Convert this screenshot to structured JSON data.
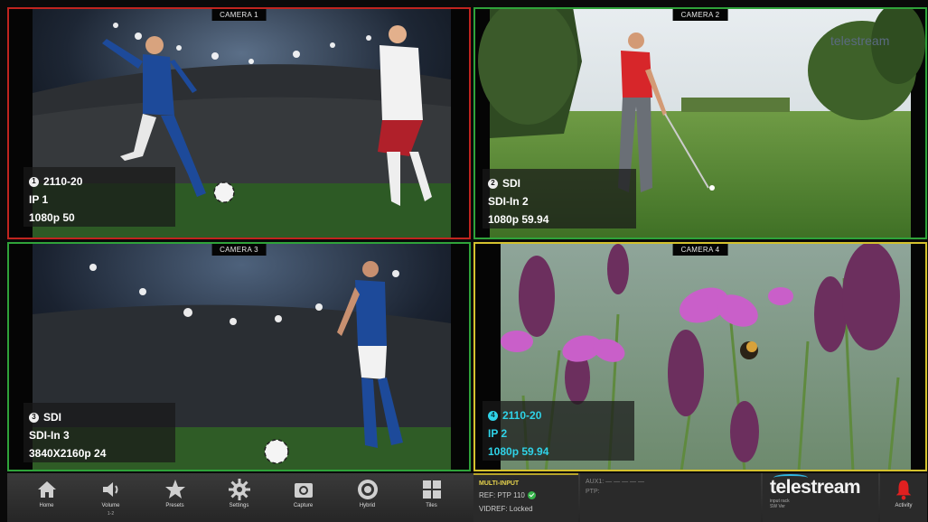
{
  "cameras": [
    {
      "label": "CAMERA 1",
      "badge": "1",
      "line1": "2110-20",
      "line2": "IP 1",
      "line3": "1080p 50",
      "border": "#c0241f"
    },
    {
      "label": "CAMERA 2",
      "badge": "2",
      "line1": "SDI",
      "line2": "SDI-In 2",
      "line3": "1080p 59.94",
      "border": "#2fa33a",
      "watermark": "telestream"
    },
    {
      "label": "CAMERA 3",
      "badge": "3",
      "line1": "SDI",
      "line2": "SDI-In 3",
      "line3": "3840X2160p 24",
      "border": "#2fa33a"
    },
    {
      "label": "CAMERA 4",
      "badge": "4",
      "line1": "2110-20",
      "line2": "IP 2",
      "line3": "1080p 59.94",
      "border": "#d4c12e"
    }
  ],
  "toolbar": {
    "items": [
      {
        "label": "Home",
        "icon": "home-icon"
      },
      {
        "label": "Volume",
        "sub": "1-2",
        "icon": "speaker-icon"
      },
      {
        "label": "Presets",
        "icon": "star-icon"
      },
      {
        "label": "Settings",
        "icon": "gear-icon"
      },
      {
        "label": "Capture",
        "icon": "camera-icon"
      },
      {
        "label": "Hybrid",
        "icon": "target-icon"
      },
      {
        "label": "Tiles",
        "icon": "tiles-icon"
      }
    ]
  },
  "status": {
    "title": "MULTI-INPUT",
    "ref": "REF: PTP 110",
    "vidref": "VIDREF: Locked",
    "aux_line1": "AUX1: — — — — —",
    "aux_line2": "PTP:"
  },
  "brand": {
    "logo": "telestream",
    "line1": "input rack",
    "line2": "SW Ver"
  },
  "activity": {
    "label": "Activity",
    "icon": "bell-icon"
  },
  "colors": {
    "red": "#c0241f",
    "green": "#2fa33a",
    "yellow": "#d4c12e",
    "cyan": "#2fd3e8"
  }
}
